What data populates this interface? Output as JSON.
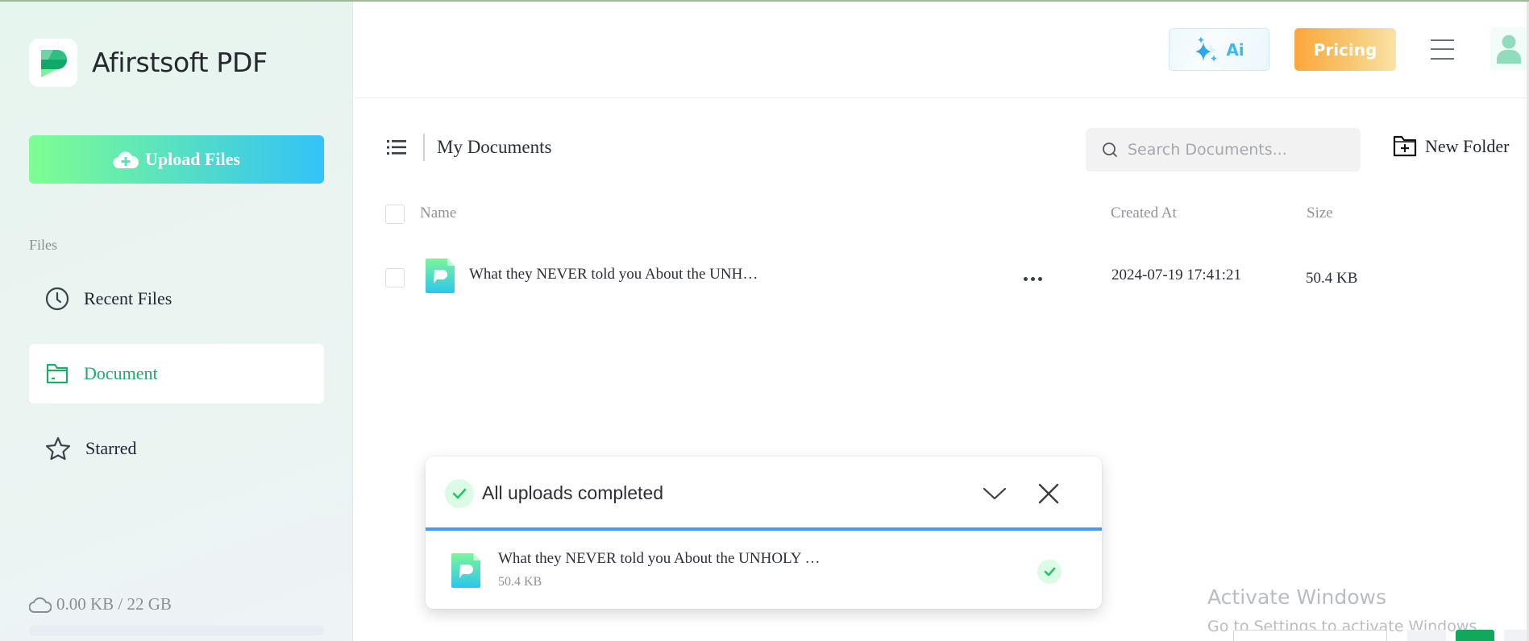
{
  "app": {
    "brand": "Afirstsoft PDF",
    "colors": {
      "accent": "#1aad6a",
      "upload_progress": "#4a98f2",
      "pricing": "#fda63b",
      "ai": "#3fb8f0"
    }
  },
  "sidebar": {
    "upload_label": "Upload Files",
    "section_label": "Files",
    "items": [
      {
        "label": "Recent Files",
        "icon": "clock-icon",
        "active": false
      },
      {
        "label": "Document",
        "icon": "folder-icon",
        "active": true
      },
      {
        "label": "Starred",
        "icon": "star-icon",
        "active": false
      }
    ],
    "storage": {
      "text": "0.00 KB / 22 GB",
      "used_fraction": 0.0
    }
  },
  "header": {
    "ai_label": "Ai",
    "pricing_label": "Pricing"
  },
  "toolbar": {
    "title": "My Documents",
    "search_placeholder": "Search Documents...",
    "search_value": "",
    "new_folder_label": "New Folder"
  },
  "table": {
    "columns": [
      "Name",
      "Created At",
      "Size"
    ],
    "rows": [
      {
        "name": "What they NEVER told you About the UNH…",
        "created_at": "2024-07-19 17:41:21",
        "size": "50.4 KB"
      }
    ]
  },
  "upload_panel": {
    "title": "All uploads completed",
    "items": [
      {
        "name": "What they NEVER told you About the UNHOLY …",
        "size": "50.4 KB",
        "status": "completed"
      }
    ]
  },
  "watermark": {
    "line1": "Activate Windows",
    "line2": "Go to Settings to activate Windows."
  }
}
